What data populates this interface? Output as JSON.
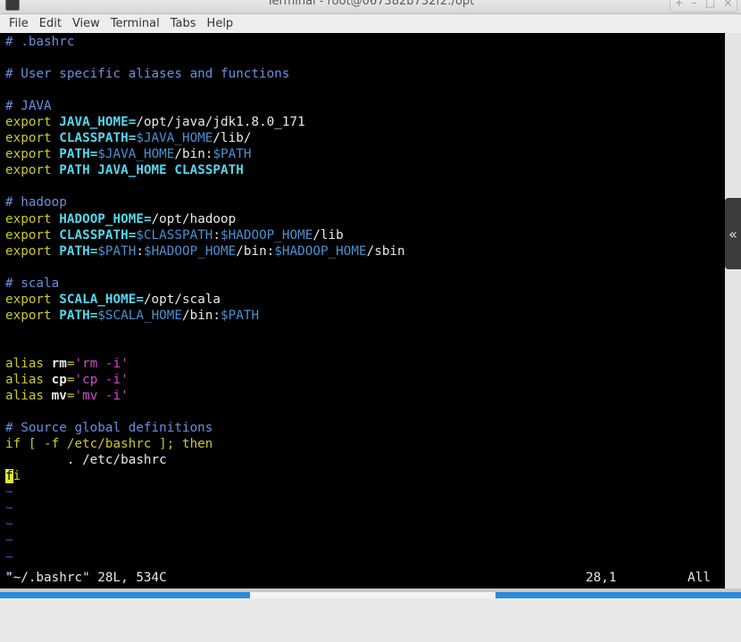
{
  "window": {
    "title": "Terminal - root@067382b732f2:/opt",
    "controls": [
      "+",
      "–",
      "□",
      "×"
    ]
  },
  "menu": [
    "File",
    "Edit",
    "View",
    "Terminal",
    "Tabs",
    "Help"
  ],
  "terminal": {
    "lines": [
      [
        [
          "# .bashrc",
          "comment"
        ]
      ],
      [],
      [
        [
          "# User specific aliases and functions",
          "comment"
        ]
      ],
      [],
      [
        [
          "# JAVA",
          "comment"
        ]
      ],
      [
        [
          "export ",
          "export"
        ],
        [
          "JAVA_HOME=",
          "var"
        ],
        [
          "/opt/java/jdk1.8.0_171",
          "plain"
        ]
      ],
      [
        [
          "export ",
          "export"
        ],
        [
          "CLASSPATH=",
          "var"
        ],
        [
          "$JAVA_HOME",
          "env"
        ],
        [
          "/lib/",
          "plain"
        ]
      ],
      [
        [
          "export ",
          "export"
        ],
        [
          "PATH=",
          "var"
        ],
        [
          "$JAVA_HOME",
          "env"
        ],
        [
          "/bin:",
          "plain"
        ],
        [
          "$PATH",
          "env"
        ]
      ],
      [
        [
          "export ",
          "export"
        ],
        [
          "PATH JAVA_HOME CLASSPATH",
          "var"
        ]
      ],
      [],
      [
        [
          "# hadoop",
          "comment"
        ]
      ],
      [
        [
          "export ",
          "export"
        ],
        [
          "HADOOP_HOME=",
          "var"
        ],
        [
          "/opt/hadoop",
          "plain"
        ]
      ],
      [
        [
          "export ",
          "export"
        ],
        [
          "CLASSPATH=",
          "var"
        ],
        [
          "$CLASSPATH",
          "env"
        ],
        [
          ":",
          "plain"
        ],
        [
          "$HADOOP_HOME",
          "env"
        ],
        [
          "/lib",
          "plain"
        ]
      ],
      [
        [
          "export ",
          "export"
        ],
        [
          "PATH=",
          "var"
        ],
        [
          "$PATH",
          "env"
        ],
        [
          ":",
          "plain"
        ],
        [
          "$HADOOP_HOME",
          "env"
        ],
        [
          "/bin:",
          "plain"
        ],
        [
          "$HADOOP_HOME",
          "env"
        ],
        [
          "/sbin",
          "plain"
        ]
      ],
      [],
      [
        [
          "# scala",
          "comment"
        ]
      ],
      [
        [
          "export ",
          "export"
        ],
        [
          "SCALA_HOME=",
          "var"
        ],
        [
          "/opt/scala",
          "plain"
        ]
      ],
      [
        [
          "export ",
          "export"
        ],
        [
          "PATH=",
          "var"
        ],
        [
          "$SCALA_HOME",
          "env"
        ],
        [
          "/bin:",
          "plain"
        ],
        [
          "$PATH",
          "env"
        ]
      ],
      [],
      [],
      [
        [
          "alias ",
          "alias"
        ],
        [
          "rm",
          "aname"
        ],
        [
          "=",
          "alias"
        ],
        [
          "'rm -i'",
          "str"
        ]
      ],
      [
        [
          "alias ",
          "alias"
        ],
        [
          "cp",
          "aname"
        ],
        [
          "=",
          "alias"
        ],
        [
          "'cp -i'",
          "str"
        ]
      ],
      [
        [
          "alias ",
          "alias"
        ],
        [
          "mv",
          "aname"
        ],
        [
          "=",
          "alias"
        ],
        [
          "'mv -i'",
          "str"
        ]
      ],
      [],
      [
        [
          "# Source global definitions",
          "comment"
        ]
      ],
      [
        [
          "if [ -f /etc/bashrc ]; then",
          "kw"
        ]
      ],
      [
        [
          "        . /etc/bashrc",
          "plain"
        ]
      ],
      [
        [
          "f",
          "cursor"
        ],
        [
          "i",
          "kw"
        ]
      ],
      [
        [
          "~",
          "tilde"
        ]
      ],
      [
        [
          "~",
          "tilde"
        ]
      ],
      [
        [
          "~",
          "tilde"
        ]
      ],
      [
        [
          "~",
          "tilde"
        ]
      ],
      [
        [
          "~",
          "tilde"
        ]
      ],
      [
        [
          "~",
          "tilde"
        ]
      ],
      [
        [
          "~",
          "tilde"
        ]
      ]
    ],
    "status_file": "\"~/.bashrc\" 28L, 534C",
    "status_position": "28,1",
    "status_scroll": "All"
  },
  "side_panel": {
    "label": "«"
  },
  "colors": {
    "terminal_bg": "#000000",
    "comment": "#6a8fdf",
    "keyword": "#c9c92a",
    "variable": "#55d7ee",
    "env_ref": "#4a90d0",
    "string": "#d04bd0",
    "cursor": "#e6e635",
    "taskbar_accent": "#2a8bd8"
  }
}
